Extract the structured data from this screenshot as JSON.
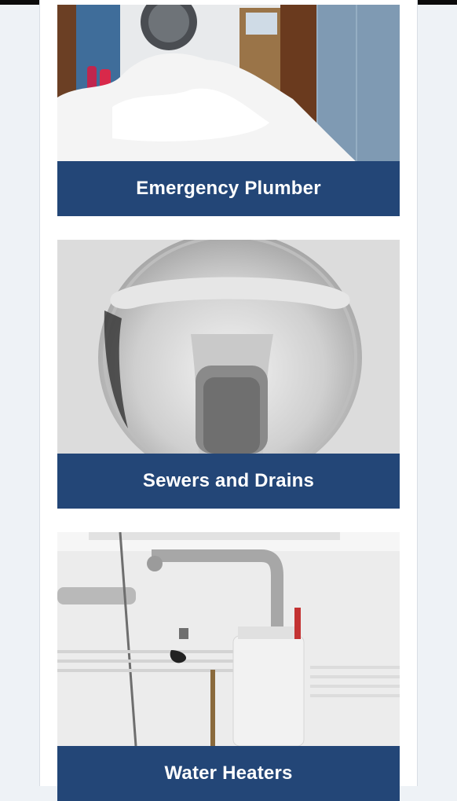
{
  "services": [
    {
      "title": "Emergency Plumber",
      "image_desc": "washing-machine-foam-overflow-image"
    },
    {
      "title": "Sewers and Drains",
      "image_desc": "toilet-bowl-image"
    },
    {
      "title": "Water Heaters",
      "image_desc": "water-heater-room-image"
    }
  ],
  "colors": {
    "banner": "#234677",
    "banner_text": "#ffffff",
    "page_bg": "#eef2f6",
    "column_bg": "#ffffff"
  }
}
